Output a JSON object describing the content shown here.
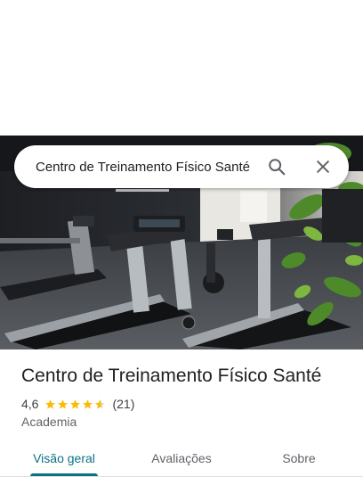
{
  "search": {
    "query": "Centro de Treinamento Físico Santé"
  },
  "place": {
    "name": "Centro de Treinamento Físico Santé",
    "rating": "4,6",
    "rating_value": 4.6,
    "review_count": "(21)",
    "category": "Academia"
  },
  "tabs": [
    {
      "label": "Visão geral",
      "selected": true
    },
    {
      "label": "Avaliações",
      "selected": false
    },
    {
      "label": "Sobre",
      "selected": false
    }
  ],
  "colors": {
    "accent": "#0b7285",
    "star": "#fbbc04",
    "text_primary": "#202124",
    "text_secondary": "#5f6368"
  },
  "icons": [
    "search-icon",
    "close-icon",
    "star-icon"
  ]
}
